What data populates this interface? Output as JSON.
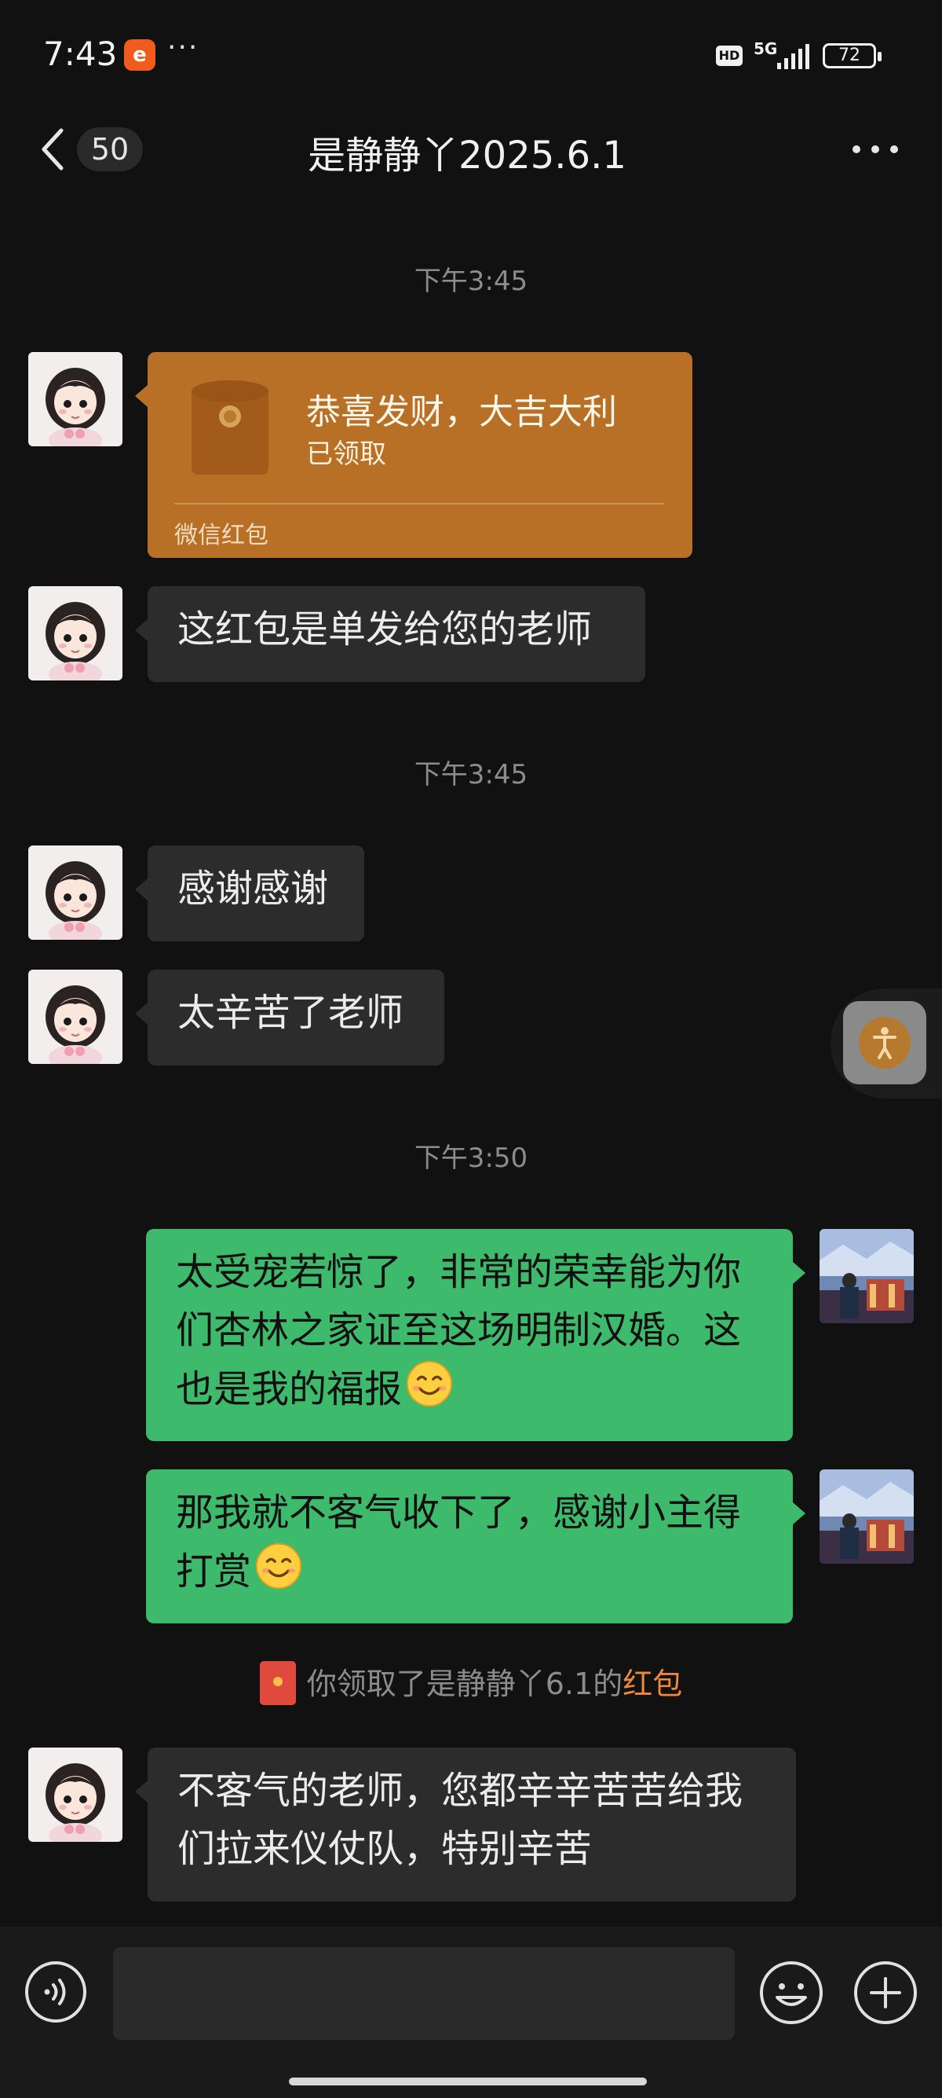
{
  "status_bar": {
    "time": "7:43",
    "app_badge": "e",
    "more": "···",
    "hd": "HD",
    "network": "5G",
    "battery": "72"
  },
  "header": {
    "unread_count": "50",
    "title": "是静静丫2025.6.1",
    "back_icon": "chevron-left-icon",
    "more_icon": "more-horizontal-icon"
  },
  "messages": {
    "ts1": "下午3:45",
    "red_packet": {
      "greeting": "恭喜发财，大吉大利",
      "status": "已领取",
      "label": "微信红包"
    },
    "m1": "这红包是单发给您的老师",
    "ts2": "下午3:45",
    "m2": "感谢感谢",
    "m3": "太辛苦了老师",
    "ts3": "下午3:50",
    "m4": "太受宠若惊了，非常的荣幸能为你们杏林之家证至这场明制汉婚。这也是我的福报",
    "m5": "那我就不客气收下了，感谢小主得打赏",
    "system": {
      "prefix": "你领取了是静静丫6.1的",
      "link": "红包"
    },
    "m6": "不客气的老师，您都辛辛苦苦给我们拉来仪仗队，特别辛苦"
  },
  "input_bar": {
    "placeholder": "",
    "voice_icon": "voice-icon",
    "emoji_icon": "emoji-icon",
    "plus_icon": "plus-icon"
  },
  "colors": {
    "background": "#111111",
    "incoming_bubble": "#2c2c2c",
    "outgoing_bubble": "#3dba6c",
    "red_packet": "#b86f26",
    "link": "#f0883a"
  }
}
